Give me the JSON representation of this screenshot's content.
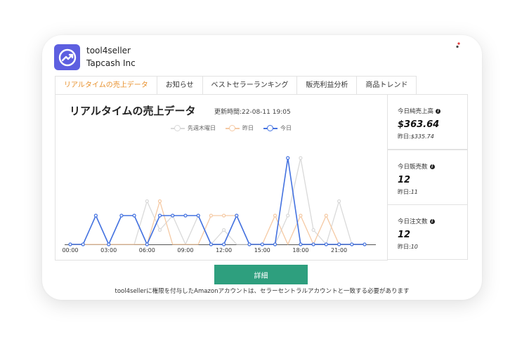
{
  "header": {
    "app_name": "tool4seller",
    "company": "Tapcash Inc"
  },
  "tabs": [
    {
      "label": "リアルタイムの売上データ",
      "active": true
    },
    {
      "label": "お知らせ",
      "active": false
    },
    {
      "label": "ベストセラーランキング",
      "active": false
    },
    {
      "label": "販売利益分析",
      "active": false
    },
    {
      "label": "商品トレンド",
      "active": false
    }
  ],
  "panel": {
    "title": "リアルタイムの売上データ",
    "update_time": "更新時間:22-08-11 19:05"
  },
  "chart_data": {
    "type": "line",
    "x_tick_labels": [
      "00:00",
      "03:00",
      "06:00",
      "09:00",
      "12:00",
      "15:00",
      "18:00",
      "21:00"
    ],
    "x": [
      0,
      1,
      2,
      3,
      4,
      5,
      6,
      7,
      8,
      9,
      10,
      11,
      12,
      13,
      14,
      15,
      16,
      17,
      18,
      19,
      20,
      21,
      22,
      23
    ],
    "ylim": [
      0,
      6
    ],
    "grid": false,
    "legend_position": "top-center",
    "series": [
      {
        "name": "先週木曜日",
        "color": "#d9d9d9",
        "values": [
          0,
          0,
          0,
          0,
          0,
          0,
          3,
          1,
          2,
          0,
          2,
          0,
          1,
          0,
          0,
          0,
          0,
          2,
          6,
          1,
          0,
          3,
          0,
          0
        ]
      },
      {
        "name": "昨日",
        "color": "#f5c9a3",
        "values": [
          0,
          0,
          0,
          0,
          0,
          0,
          0,
          3,
          0,
          0,
          0,
          2,
          2,
          2,
          0,
          0,
          2,
          0,
          2,
          0,
          2,
          0,
          0,
          0
        ]
      },
      {
        "name": "今日",
        "color": "#4472e0",
        "values": [
          0,
          0,
          2,
          0,
          2,
          2,
          0,
          2,
          2,
          2,
          2,
          0,
          0,
          2,
          0,
          0,
          0,
          6,
          0,
          0,
          0,
          0,
          0,
          0
        ]
      }
    ]
  },
  "stats": [
    {
      "label": "今日純売上高",
      "value": "$363.64",
      "prev_label": "昨日:",
      "prev_value": "$335.74"
    },
    {
      "label": "今日販売数",
      "value": "12",
      "prev_label": "昨日:",
      "prev_value": "11"
    },
    {
      "label": "今日注文数",
      "value": "12",
      "prev_label": "昨日:",
      "prev_value": "10"
    }
  ],
  "button": {
    "detail_label": "詳細"
  },
  "footnote": "tool4sellerに権限を付与したAmazonアカウントは、セラーセントラルアカウントと一致する必要があります",
  "colors": {
    "accent": "#e8912d",
    "logo": "#5d5fe0",
    "button": "#2e9f7e"
  },
  "icons": {
    "logo": "trending-up-icon",
    "menu": "more-vertical-icon",
    "info": "info-icon"
  }
}
